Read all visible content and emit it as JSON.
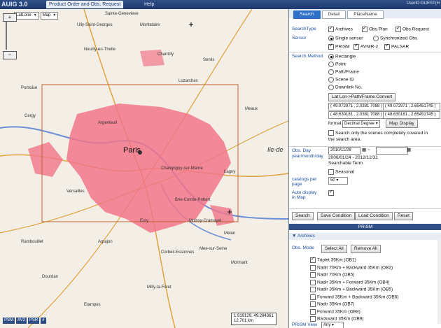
{
  "topbar": {
    "app_title": "AUIG 3.0",
    "tab_order": "Product Order and Obs. Request",
    "tab_help": "Help",
    "user": "UserID:GUEST(H"
  },
  "map": {
    "coord_system": "LatLone",
    "layer": "Map",
    "place_labels": [
      "Sainte-Genevieve",
      "Ully-Saint-Georges",
      "Montataire",
      "Neuilly-en-Thelle",
      "Chantilly",
      "Senlis",
      "Luzarches",
      "Paris",
      "Ile-de",
      "Versailles",
      "Evry",
      "Melun",
      "Brie-Comte-Robert",
      "Cergy",
      "Pontoise",
      "Rambouillet",
      "Etampes",
      "Milly-la-Foret",
      "Meaux",
      "Lagny",
      "Mormant",
      "Dourdan",
      "Arpajon",
      "Moissy-Cramayel",
      "Corbeil-Essonnes",
      "Mee-sur-Seine",
      "Champigny-sur-Marne",
      "Argenteuil"
    ],
    "buttons": [
      "PSM",
      "AV2",
      "PSR",
      "#"
    ],
    "coord_readout_1": "1.919129, 49.284361",
    "coord_readout_2": "12.701 km"
  },
  "panel": {
    "tabs": [
      "Search",
      "Detail",
      "PlaceName"
    ],
    "search_type_label": "SearchType",
    "search_types": [
      "Archives",
      "Obs.Plan",
      "Obs.Request"
    ],
    "sensor_label": "Sensor",
    "sensor_modes": [
      "Single sensor",
      "Synchronized Obs."
    ],
    "sensors": [
      "PRISM",
      "AVNIR-2",
      "PALSAR"
    ],
    "search_method_label": "Search Method",
    "methods": [
      "Rectangle",
      "Point",
      "Path/Frame",
      "Scene ID",
      "Downlink No."
    ],
    "convert_button": "Lat Lon->Path/Frame Convert",
    "coords": [
      "( 49.072971 , 2.0381 7088 )",
      "( 49.072971 , 2.65451745 )",
      "( 48.630181 , 2.0381 7088 )",
      "( 48.630181 , 2.65451745 )"
    ],
    "format_label": "format",
    "format_value": "Decimal Degree",
    "map_display_button": "Map Display",
    "cover_option": "Search only the scenes completely covered in the search area.",
    "obs_day_label": "Obs. Day",
    "obs_day_sub": "year/month/day",
    "date_from": "2010/11/26",
    "date_to": "",
    "searchable_term": "2006/01/24 - 2012/12/31",
    "searchable_term_label": "Searchable Term",
    "seasonal_label": "Seasonal",
    "catalogs_label": "catalogs per page",
    "catalogs_value": "50",
    "auto_display_label": "Auto display in Map",
    "action_buttons": [
      "Search",
      "Save Condition",
      "Load Condition",
      "Reset"
    ],
    "prism_header": "PRISM",
    "archives_header": "Archives",
    "obs_mode_label": "Obs. Mode",
    "select_all": "Select All",
    "remove_all": "Remove All",
    "obs_modes": [
      "Triplet 35Km (OB1)",
      "Nadir 70Km + Backward 35Km (OB2)",
      "Nadir 70Km (OB5)",
      "Nadir 35Km + Forward 35Km (OB4)",
      "Nadir 35Km + Backward 35Km (OB5)",
      "Forward 35Km + Backward 35Km (OB6)",
      "Nadir 35Km (OB7)",
      "Forward 35Km (OB8)",
      "Backward 35Km (OB9)"
    ],
    "prism_view_label": "PRISM View",
    "prism_view_value": "Any"
  }
}
